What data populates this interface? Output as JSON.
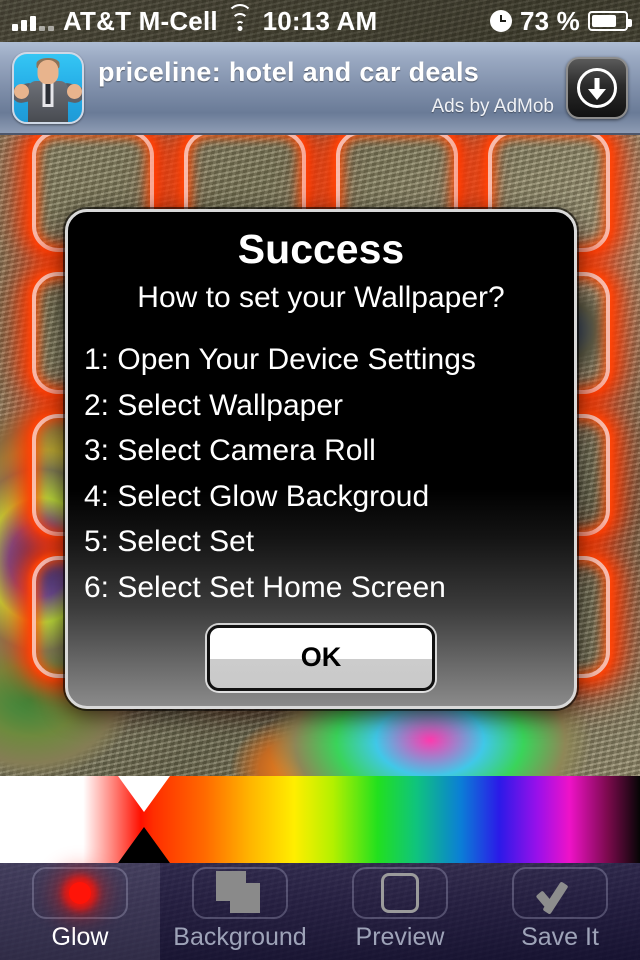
{
  "status_bar": {
    "signal_icon": "signal-bars-icon",
    "carrier": "AT&T M-Cell",
    "wifi_icon": "wifi-icon",
    "time": "10:13 AM",
    "clock_icon": "alarm-clock-icon",
    "battery_percent": "73 %",
    "battery_icon": "battery-icon"
  },
  "ad_banner": {
    "app_icon": "priceline-app-icon",
    "title": "priceline: hotel and car deals",
    "attribution": "Ads by AdMob",
    "download_icon": "download-arrow-icon"
  },
  "dialog": {
    "title": "Success",
    "subtitle": "How to set your Wallpaper?",
    "steps": [
      "1: Open Your Device Settings",
      "2: Select Wallpaper",
      "3: Select Camera Roll",
      "4: Select Glow Backgroud",
      "5: Select Set",
      "6: Select Set Home Screen"
    ],
    "ok_label": "OK"
  },
  "color_slider": {
    "name": "glow-color-slider",
    "marker_position_px": 144,
    "marker_up_color": "#ffffff",
    "marker_down_color": "#000000",
    "gradient_stops": [
      "#ffffff",
      "#ff1000",
      "#ff6a00",
      "#ffee00",
      "#22e01e",
      "#0b7ed6",
      "#2b1ae8",
      "#ef12c8",
      "#050505"
    ]
  },
  "tabbar": {
    "tabs": [
      {
        "label": "Glow",
        "icon": "red-glow-dot-icon",
        "selected": true
      },
      {
        "label": "Background",
        "icon": "stacked-squares-icon",
        "selected": false
      },
      {
        "label": "Preview",
        "icon": "empty-frame-icon",
        "selected": false
      },
      {
        "label": "Save It",
        "icon": "checkmark-icon",
        "selected": false
      }
    ]
  },
  "wallpaper": {
    "name": "fractal-wallpaper-preview",
    "glow_color": "#ff3c00",
    "glow_outline_color": "#ffbeaf"
  }
}
